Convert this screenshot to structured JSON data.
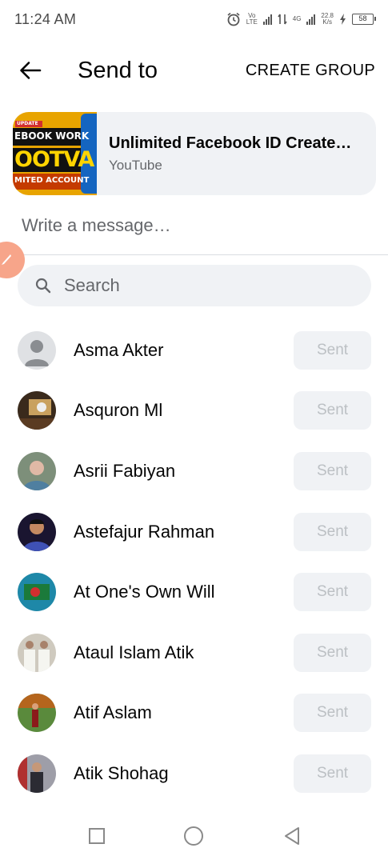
{
  "status_bar": {
    "time": "11:24 AM",
    "volte": "Vo LTE",
    "network": "4G",
    "speed_value": "22.8",
    "speed_unit": "K/s",
    "battery": "58"
  },
  "header": {
    "title": "Send to",
    "create_group": "CREATE GROUP"
  },
  "preview": {
    "thumb_line1": "UPDATE",
    "thumb_line2": "EBOOK WORK",
    "thumb_line3": "OOTVA",
    "thumb_line4": "MITED ACCOUNT",
    "title": "Unlimited Facebook ID Create…",
    "source": "YouTube"
  },
  "message": {
    "placeholder": "Write a message…"
  },
  "search": {
    "placeholder": "Search"
  },
  "contacts": [
    {
      "name": "Asma Akter",
      "action": "Sent",
      "avatar_colors": [
        "#dfe1e4",
        "#8a8d91"
      ]
    },
    {
      "name": "Asquron Ml",
      "action": "Sent",
      "avatar_colors": [
        "#3a2a1c",
        "#c9a15f"
      ]
    },
    {
      "name": "Asrii Fabiyan",
      "action": "Sent",
      "avatar_colors": [
        "#7d8f7a",
        "#e0b9a6"
      ]
    },
    {
      "name": "Astefajur Rahman",
      "action": "Sent",
      "avatar_colors": [
        "#1a1530",
        "#3f51b5"
      ]
    },
    {
      "name": "At One's Own Will",
      "action": "Sent",
      "avatar_colors": [
        "#1e88a8",
        "#d32f2f"
      ]
    },
    {
      "name": "Ataul Islam Atik",
      "action": "Sent",
      "avatar_colors": [
        "#cfcabf",
        "#f5f5f0"
      ]
    },
    {
      "name": "Atif Aslam",
      "action": "Sent",
      "avatar_colors": [
        "#5a8a3c",
        "#b5651d"
      ]
    },
    {
      "name": "Atik Shohag",
      "action": "Sent",
      "avatar_colors": [
        "#9e9ea8",
        "#2b2b33"
      ]
    }
  ],
  "colors": {
    "accent_fab": "#f7a58a",
    "surface": "#f0f2f5",
    "secondary_text": "#65676b",
    "disabled_text": "#bcc0c4"
  },
  "icons": {
    "back": "arrow-left-icon",
    "search": "search-icon",
    "fab": "pencil-icon",
    "nav": [
      "square-icon",
      "circle-icon",
      "triangle-back-icon"
    ]
  }
}
